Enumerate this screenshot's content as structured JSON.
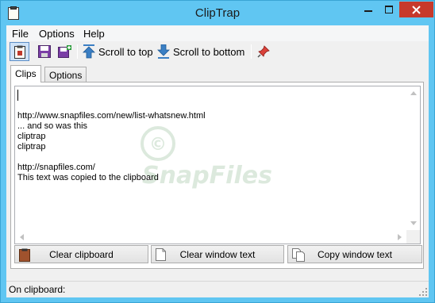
{
  "window": {
    "title": "ClipTrap",
    "controls": [
      "minimize",
      "maximize",
      "close"
    ]
  },
  "menu": {
    "items": [
      "File",
      "Options",
      "Help"
    ]
  },
  "toolbar": {
    "scroll_top_label": "Scroll to top",
    "scroll_bottom_label": "Scroll to bottom",
    "icons": [
      "clipboard-icon",
      "save-icon",
      "save-all-icon",
      "arrow-up-icon",
      "arrow-down-icon",
      "pin-icon"
    ]
  },
  "tabs": {
    "clips": "Clips",
    "options": "Options",
    "active": "Clips"
  },
  "editor": {
    "lines": [
      "http://www.snapfiles.com/new/list-whatsnew.html",
      "... and so was this",
      "cliptrap",
      "cliptrap",
      "",
      "http://snapfiles.com/",
      "This text was copied to the clipboard"
    ]
  },
  "watermark": {
    "text": "SnapFiles",
    "symbol": "©"
  },
  "buttons": {
    "clear_clipboard": "Clear clipboard",
    "clear_window_text": "Clear window text",
    "copy_window_text": "Copy window text"
  },
  "status": {
    "label": "On clipboard:"
  },
  "colors": {
    "titlebar": "#60c6f2",
    "close_button": "#c7392b",
    "toolbar_icon_blue": "#3b7fc4"
  }
}
